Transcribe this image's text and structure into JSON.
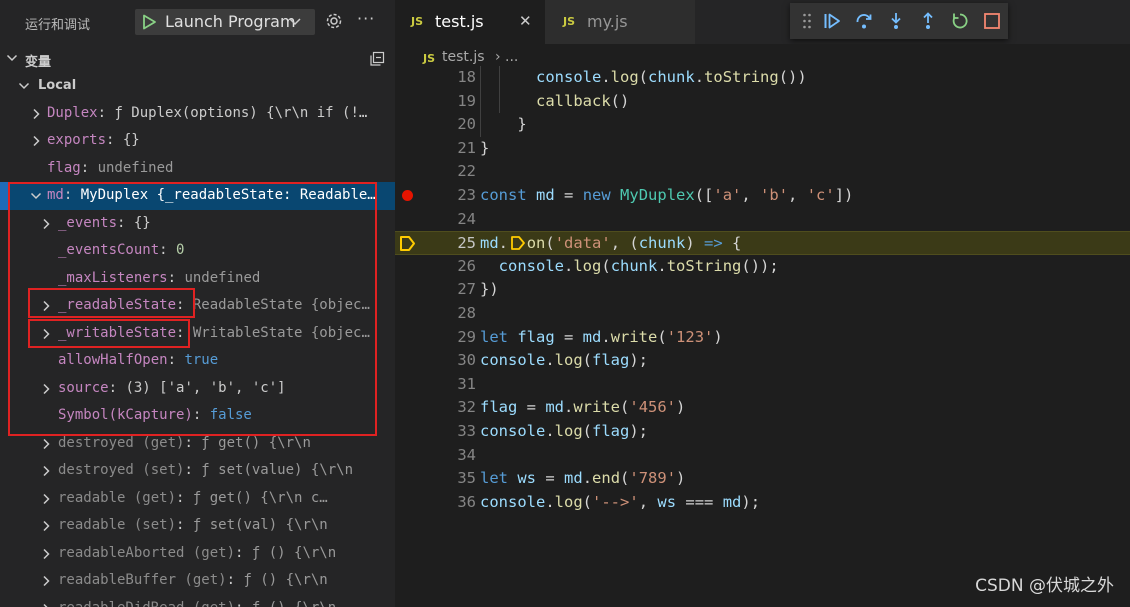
{
  "sidebar": {
    "title": "运行和调试",
    "launch_config": "Launch Program",
    "more": "···",
    "variables_title": "变量",
    "scope": "Local",
    "rows": [
      {
        "key": "Duplex",
        "value": "ƒ Duplex(options) {\\r\\n  if (!…"
      },
      {
        "key": "exports",
        "value": "{}"
      },
      {
        "key": "flag",
        "value": "undefined"
      },
      {
        "key": "md",
        "value": "MyDuplex {_readableState: Readable…"
      },
      {
        "key": "_events",
        "value": "{}"
      },
      {
        "key": "_eventsCount",
        "value": "0"
      },
      {
        "key": "_maxListeners",
        "value": "undefined"
      },
      {
        "key": "_readableState",
        "value": "ReadableState {objec…"
      },
      {
        "key": "_writableState",
        "value": "WritableState {objec…"
      },
      {
        "key": "allowHalfOpen",
        "value": "true"
      },
      {
        "key": "source",
        "value": "(3) ['a', 'b', 'c']"
      },
      {
        "key": "Symbol(kCapture)",
        "value": "false"
      },
      {
        "key": "destroyed (get)",
        "value": "ƒ get() {\\r\\n"
      },
      {
        "key": "destroyed (set)",
        "value": "ƒ set(value) {\\r\\n"
      },
      {
        "key": "readable (get)",
        "value": "ƒ get() {\\r\\n      c…"
      },
      {
        "key": "readable (set)",
        "value": "ƒ set(val) {\\r\\n"
      },
      {
        "key": "readableAborted (get)",
        "value": "ƒ () {\\r\\n"
      },
      {
        "key": "readableBuffer (get)",
        "value": "ƒ () {\\r\\n"
      },
      {
        "key": "readableDidRead (get)",
        "value": "ƒ () {\\r\\n"
      }
    ]
  },
  "editor": {
    "tabs": [
      {
        "badge": "JS",
        "name": "test.js",
        "close": "✕"
      },
      {
        "badge": "JS",
        "name": "my.js"
      }
    ],
    "breadcrumb": {
      "badge": "JS",
      "file": "test.js",
      "sep": "›",
      "more": "..."
    },
    "lines": [
      {
        "n": "18",
        "parts": [
          [
            "      ",
            ""
          ],
          [
            "console",
            "var"
          ],
          [
            ".",
            ""
          ],
          [
            "log",
            "fn"
          ],
          [
            "(",
            ""
          ],
          [
            "chunk",
            "var"
          ],
          [
            ".",
            ""
          ],
          [
            "toString",
            "fn"
          ],
          [
            "())",
            ""
          ]
        ]
      },
      {
        "n": "19",
        "parts": [
          [
            "      ",
            ""
          ],
          [
            "callback",
            "fn"
          ],
          [
            "()",
            ""
          ]
        ]
      },
      {
        "n": "20",
        "parts": [
          [
            "    }",
            ""
          ]
        ]
      },
      {
        "n": "21",
        "parts": [
          [
            "}",
            ""
          ]
        ]
      },
      {
        "n": "22",
        "parts": []
      },
      {
        "n": "23",
        "parts": [
          [
            "const",
            "kw"
          ],
          [
            " ",
            ""
          ],
          [
            "md",
            "var"
          ],
          [
            " = ",
            ""
          ],
          [
            "new",
            "kw"
          ],
          [
            " ",
            ""
          ],
          [
            "MyDuplex",
            "cls"
          ],
          [
            "([",
            ""
          ],
          [
            "'a'",
            "str"
          ],
          [
            ", ",
            ""
          ],
          [
            "'b'",
            "str"
          ],
          [
            ", ",
            ""
          ],
          [
            "'c'",
            "str"
          ],
          [
            "])",
            ""
          ]
        ]
      },
      {
        "n": "24",
        "parts": []
      },
      {
        "n": "25",
        "parts": [
          [
            "md",
            "var"
          ],
          [
            ".",
            ""
          ],
          [
            "  ",
            ""
          ],
          [
            "on",
            "fn"
          ],
          [
            "(",
            ""
          ],
          [
            "'data'",
            "str"
          ],
          [
            ", (",
            ""
          ],
          [
            "chunk",
            "var"
          ],
          [
            ") ",
            ""
          ],
          [
            "=>",
            "kw"
          ],
          [
            " {",
            ""
          ]
        ]
      },
      {
        "n": "26",
        "parts": [
          [
            "  ",
            ""
          ],
          [
            "console",
            "var"
          ],
          [
            ".",
            ""
          ],
          [
            "log",
            "fn"
          ],
          [
            "(",
            ""
          ],
          [
            "chunk",
            "var"
          ],
          [
            ".",
            ""
          ],
          [
            "toString",
            "fn"
          ],
          [
            "());",
            ""
          ]
        ]
      },
      {
        "n": "27",
        "parts": [
          [
            "})",
            ""
          ]
        ]
      },
      {
        "n": "28",
        "parts": []
      },
      {
        "n": "29",
        "parts": [
          [
            "let",
            "kw"
          ],
          [
            " ",
            ""
          ],
          [
            "flag",
            "var"
          ],
          [
            " = ",
            ""
          ],
          [
            "md",
            "var"
          ],
          [
            ".",
            ""
          ],
          [
            "write",
            "fn"
          ],
          [
            "(",
            ""
          ],
          [
            "'123'",
            "str"
          ],
          [
            ")",
            ""
          ]
        ]
      },
      {
        "n": "30",
        "parts": [
          [
            "console",
            "var"
          ],
          [
            ".",
            ""
          ],
          [
            "log",
            "fn"
          ],
          [
            "(",
            ""
          ],
          [
            "flag",
            "var"
          ],
          [
            ");",
            ""
          ]
        ]
      },
      {
        "n": "31",
        "parts": []
      },
      {
        "n": "32",
        "parts": [
          [
            "flag",
            "var"
          ],
          [
            " = ",
            ""
          ],
          [
            "md",
            "var"
          ],
          [
            ".",
            ""
          ],
          [
            "write",
            "fn"
          ],
          [
            "(",
            ""
          ],
          [
            "'456'",
            "str"
          ],
          [
            ")",
            ""
          ]
        ]
      },
      {
        "n": "33",
        "parts": [
          [
            "console",
            "var"
          ],
          [
            ".",
            ""
          ],
          [
            "log",
            "fn"
          ],
          [
            "(",
            ""
          ],
          [
            "flag",
            "var"
          ],
          [
            ");",
            ""
          ]
        ]
      },
      {
        "n": "34",
        "parts": []
      },
      {
        "n": "35",
        "parts": [
          [
            "let",
            "kw"
          ],
          [
            " ",
            ""
          ],
          [
            "ws",
            "var"
          ],
          [
            " = ",
            ""
          ],
          [
            "md",
            "var"
          ],
          [
            ".",
            ""
          ],
          [
            "end",
            "fn"
          ],
          [
            "(",
            ""
          ],
          [
            "'789'",
            "str"
          ],
          [
            ")",
            ""
          ]
        ]
      },
      {
        "n": "36",
        "parts": [
          [
            "console",
            "var"
          ],
          [
            ".",
            ""
          ],
          [
            "log",
            "fn"
          ],
          [
            "(",
            ""
          ],
          [
            "'-->'",
            "str"
          ],
          [
            ", ",
            ""
          ],
          [
            "ws",
            "var"
          ],
          [
            " === ",
            ""
          ],
          [
            "md",
            "var"
          ],
          [
            ");",
            ""
          ]
        ]
      }
    ],
    "breakpoint_line": "23",
    "current_line": "25"
  },
  "debug_toolbar": [
    "drag-handle-icon",
    "continue-icon",
    "step-over-icon",
    "step-into-icon",
    "step-out-icon",
    "restart-icon",
    "stop-icon"
  ],
  "colors": {
    "accent": "#094771",
    "breakpoint": "#e51400",
    "current_line": "#ffcc00",
    "highlight_box": "#e02222"
  },
  "watermark": "CSDN @伏城之外"
}
